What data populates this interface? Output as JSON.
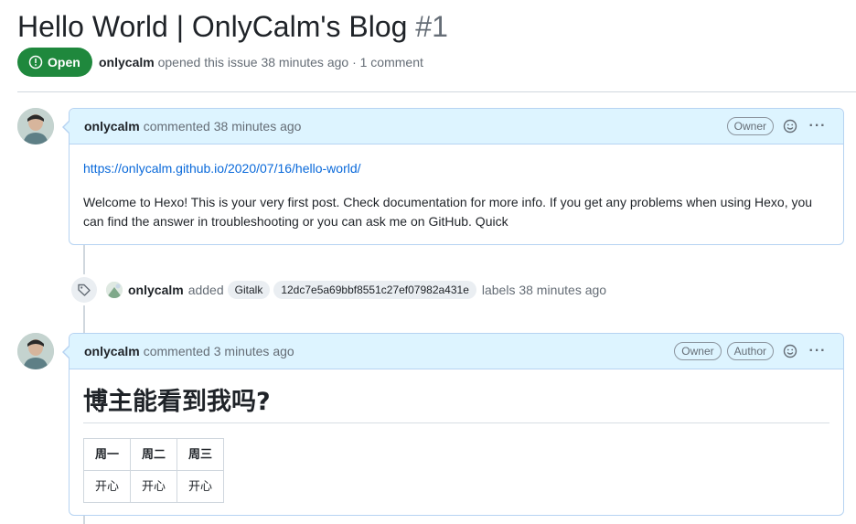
{
  "issue": {
    "title": "Hello World | OnlyCalm's Blog",
    "number": "#1",
    "state_label": "Open",
    "author": "onlycalm",
    "meta_text": "opened this issue 38 minutes ago · 1 comment",
    "state_color": "#1f883d"
  },
  "comments": [
    {
      "author": "onlycalm",
      "action_text": "commented 38 minutes ago",
      "badges": [
        "Owner"
      ],
      "link": "https://onlycalm.github.io/2020/07/16/hello-world/",
      "body": "Welcome to Hexo! This is your very first post. Check documentation for more info. If you get any problems when using Hexo, you can find the answer in troubleshooting or you can ask me on GitHub. Quick"
    },
    {
      "author": "onlycalm",
      "action_text": "commented 3 minutes ago",
      "badges": [
        "Owner",
        "Author"
      ],
      "heading": "博主能看到我吗?",
      "table": {
        "headers": [
          "周一",
          "周二",
          "周三"
        ],
        "rows": [
          [
            "开心",
            "开心",
            "开心"
          ]
        ]
      }
    }
  ],
  "event": {
    "icon": "tag-icon",
    "author": "onlycalm",
    "action": "added",
    "labels": [
      "Gitalk",
      "12dc7e5a69bbf8551c27ef07982a431e"
    ],
    "suffix": "labels 38 minutes ago"
  },
  "icons": [
    "issue-opened-icon",
    "smiley-icon",
    "kebab-horizontal-icon",
    "tag-icon"
  ]
}
